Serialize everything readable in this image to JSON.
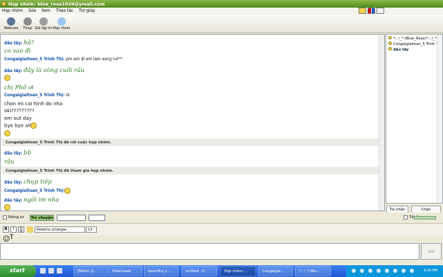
{
  "window": {
    "title": "Họp nhóm: blue_rose1026@ymail.com"
  },
  "menu": [
    "Họp nhóm",
    "Sửa",
    "Xem",
    "Thao tác",
    "Trợ giúp"
  ],
  "toolbar": [
    "Webcam",
    "Thoại",
    "Gửi tập tin",
    "Họp nhóm"
  ],
  "top_right_icons": [
    "smiley-icon",
    "flag-icon",
    "wc-icon"
  ],
  "chat": [
    {
      "type": "sender",
      "name": "dâu tây:",
      "message": "hả?"
    },
    {
      "type": "body",
      "text": "co vao đi",
      "style": "italic"
    },
    {
      "type": "sender",
      "name": "Congaigiaitoan_5 Trinh Thị:",
      "message": "pm em di em lam xong ruiᴹᴹ"
    },
    {
      "type": "sender",
      "name": "dâu tây:",
      "message": "đây là vòng cuối rầu"
    },
    {
      "type": "emoji"
    },
    {
      "type": "body",
      "text": "chị Phố ơi",
      "style": "italic"
    },
    {
      "type": "sender",
      "name": "Congaigiaitoan_5 Trinh Thị:",
      "message": "ừi"
    },
    {
      "type": "body",
      "text": "chon mi cai hinh do nha"
    },
    {
      "type": "body",
      "text": "oki?????????"
    },
    {
      "type": "body",
      "text": "em out day"
    },
    {
      "type": "body",
      "text": "bye bye all"
    },
    {
      "type": "emoji"
    },
    {
      "type": "system",
      "text": "Congaigiaitoan_5 Trinh Thị đã rời cuộc họp nhóm."
    },
    {
      "type": "sender",
      "name": "dâu tây:",
      "message": "bb"
    },
    {
      "type": "body",
      "text": "râu",
      "style": "italic"
    },
    {
      "type": "system",
      "text": "Congaigiaitoan_5 Trinh Thị đã tham gia họp nhóm."
    },
    {
      "type": "sender",
      "name": "dâu tây:",
      "message": "chụp tiếp"
    },
    {
      "type": "sender",
      "name": "Congaigiaitoan_5 Trinh Thị:",
      "message": ""
    },
    {
      "type": "sender",
      "name": "dâu tây:",
      "message": "ngồi im nha"
    },
    {
      "type": "emoji"
    }
  ],
  "sidebar": {
    "members": [
      {
        "name": "*-, i_*-(Blue_Rose)*-, i_*",
        "bold": false
      },
      {
        "name": "Congaigiaitoan_5 Trinh Thị",
        "bold": false
      },
      {
        "name": "dâu tây",
        "bold": true
      }
    ],
    "buttons": [
      "Tin nhắn",
      "Chặn"
    ]
  },
  "controls": {
    "private_label": "Riêng tư",
    "mode_label": "Trò chuyện",
    "sound_label": "Tắt âm"
  },
  "format": {
    "font": "Palatino Linotype",
    "size": "13"
  },
  "send_label": "Gửi",
  "taskbar": {
    "start": "start",
    "items": [
      "[Nhóm 1]...",
      "Downloads",
      "beautiful_s...",
      "untitled - P...",
      "Họp nhóm:...",
      "Congaigiai...",
      "*-, i_*-(Blu..."
    ],
    "clock": "4:10 PM"
  }
}
